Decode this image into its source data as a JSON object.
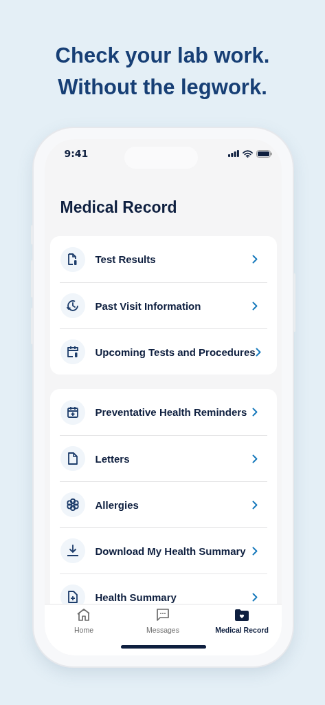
{
  "headline": [
    "Check your lab work.",
    "Without the legwork."
  ],
  "status_bar": {
    "time": "9:41"
  },
  "title": "Medical Record",
  "sections": [
    {
      "items": [
        {
          "label": "Test Results"
        },
        {
          "label": "Past Visit Information"
        },
        {
          "label": "Upcoming Tests and Procedures"
        }
      ]
    },
    {
      "items": [
        {
          "label": "Preventative Health Reminders"
        },
        {
          "label": "Letters"
        },
        {
          "label": "Allergies"
        },
        {
          "label": "Download My Health Summary"
        },
        {
          "label": "Health Summary"
        }
      ]
    }
  ],
  "tabs": [
    {
      "label": "Home",
      "selected": false
    },
    {
      "label": "Messages",
      "selected": false
    },
    {
      "label": "Medical Record",
      "selected": true
    }
  ]
}
